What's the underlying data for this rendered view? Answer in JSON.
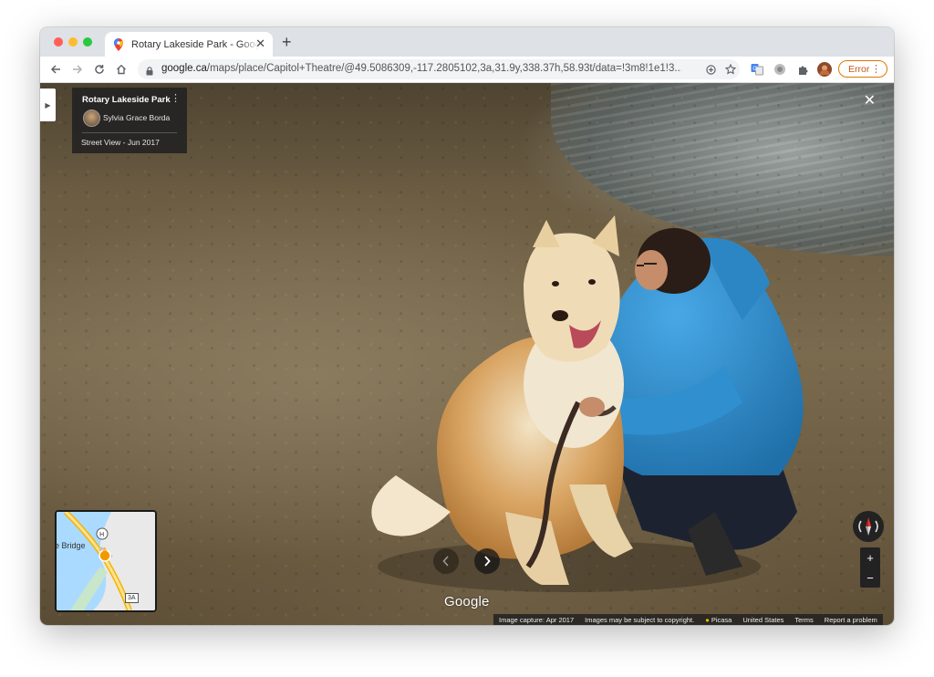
{
  "browser": {
    "tab_title": "Rotary Lakeside Park - Google",
    "tab_close_glyph": "✕",
    "new_tab_glyph": "+",
    "url_host": "google.ca",
    "url_path": "/maps/place/Capitol+Theatre/@49.5086309,-117.2805102,3a,31.9y,338.37h,58.93t/data=!3m8!1e1!3...",
    "error_label": "Error",
    "icons": [
      "back-icon",
      "forward-icon",
      "reload-icon",
      "home-icon",
      "lock-icon",
      "add-icon",
      "star-icon",
      "translate-icon",
      "extension-icon",
      "puzzle-icon",
      "avatar-icon",
      "more-icon"
    ]
  },
  "streetview": {
    "place_name": "Rotary Lakeside Park",
    "author": "Sylvia Grace Borda",
    "date": "Street View - Jun 2017",
    "google_logo": "Google",
    "minimap_label": "e Bridge",
    "minimap_highway": "3A",
    "footer": {
      "capture": "Image capture: Apr 2017",
      "copyright": "Images may be subject to copyright.",
      "picasa": "Picasa",
      "country": "United States",
      "terms": "Terms",
      "report": "Report a problem"
    },
    "zoom_in": "+",
    "zoom_out": "−"
  },
  "colors": {
    "error_accent": "#e37400",
    "tab_strip": "#dee1e6",
    "jacket": "#2f8fcf"
  }
}
